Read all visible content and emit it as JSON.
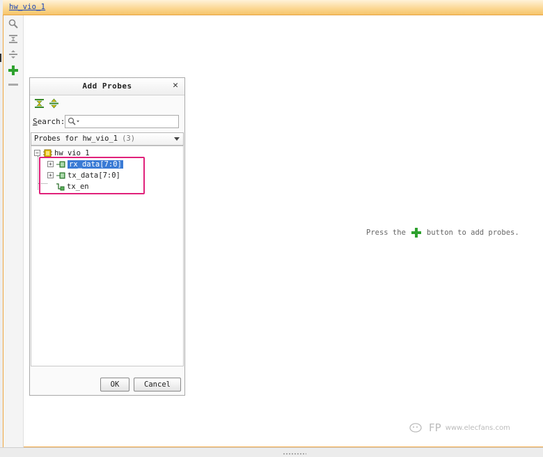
{
  "window": {
    "tab_title": "hw_vio_1"
  },
  "toolbar": {
    "items": [
      {
        "icon": "search-icon"
      },
      {
        "icon": "collapse-all-icon"
      },
      {
        "icon": "expand-all-icon"
      },
      {
        "icon": "add-icon"
      },
      {
        "icon": "remove-icon"
      }
    ]
  },
  "main": {
    "msg_before": "Press the",
    "msg_after": "button to add probes."
  },
  "dialog": {
    "title": "Add Probes",
    "search_label_underlined": "S",
    "search_label_rest": "earch:",
    "search_placeholder": "",
    "filter": {
      "label": "Probes for hw_vio_1",
      "count": "(3)"
    },
    "tree": {
      "root": "hw_vio_1",
      "children": [
        {
          "label": "rx_data[7:0]",
          "selected": true,
          "expandable": true
        },
        {
          "label": "tx_data[7:0]",
          "selected": false,
          "expandable": true
        },
        {
          "label": "tx_en",
          "selected": false,
          "expandable": false
        }
      ]
    },
    "ok_label": "OK",
    "cancel_label": "Cancel"
  },
  "watermark": {
    "text": "FP",
    "sub": "www.elecfans.com"
  },
  "colors": {
    "accent_orange": "#f0a640",
    "highlight_pink": "#e0217a",
    "selection_blue": "#3a7bd5",
    "plus_green": "#2ea12e"
  }
}
